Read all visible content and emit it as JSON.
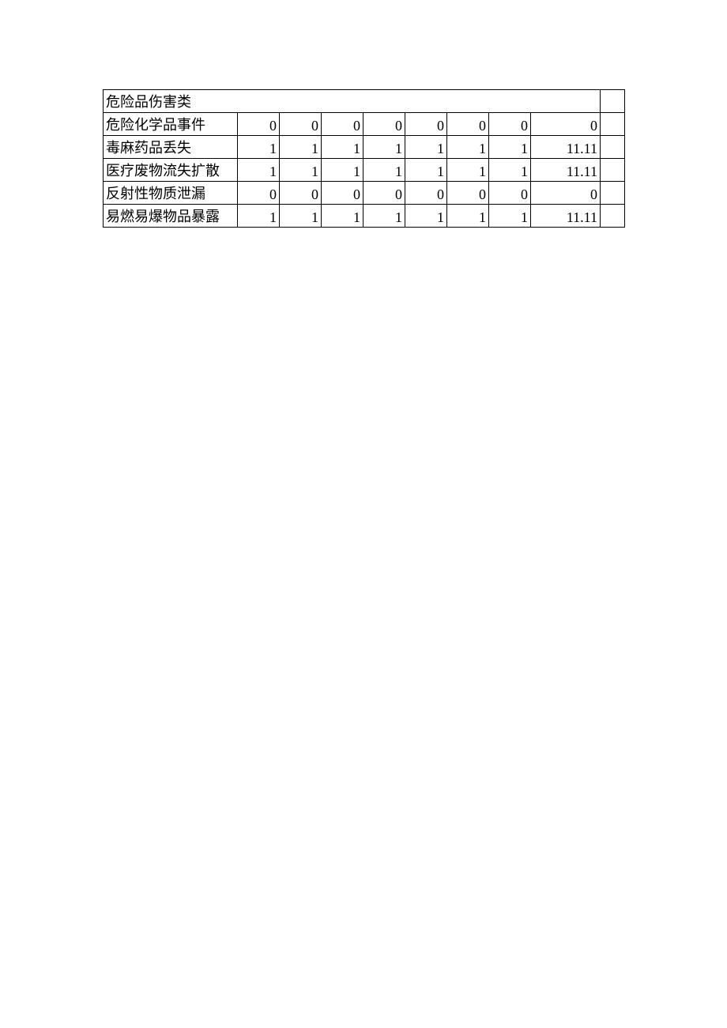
{
  "table": {
    "section_title": "危险品伤害类",
    "rows": [
      {
        "label": "危险化学品事件",
        "c1": "0",
        "c2": "0",
        "c3": "0",
        "c4": "0",
        "c5": "0",
        "c6": "0",
        "c7": "0",
        "c8": "0"
      },
      {
        "label": "毒麻药品丢失",
        "c1": "1",
        "c2": "1",
        "c3": "1",
        "c4": "1",
        "c5": "1",
        "c6": "1",
        "c7": "1",
        "c8": "11.11"
      },
      {
        "label": "医疗废物流失扩散",
        "c1": "1",
        "c2": "1",
        "c3": "1",
        "c4": "1",
        "c5": "1",
        "c6": "1",
        "c7": "1",
        "c8": "11.11"
      },
      {
        "label": "反射性物质泄漏",
        "c1": "0",
        "c2": "0",
        "c3": "0",
        "c4": "0",
        "c5": "0",
        "c6": "0",
        "c7": "0",
        "c8": "0"
      },
      {
        "label": "易燃易爆物品暴露",
        "c1": "1",
        "c2": "1",
        "c3": "1",
        "c4": "1",
        "c5": "1",
        "c6": "1",
        "c7": "1",
        "c8": "11.11"
      }
    ]
  }
}
